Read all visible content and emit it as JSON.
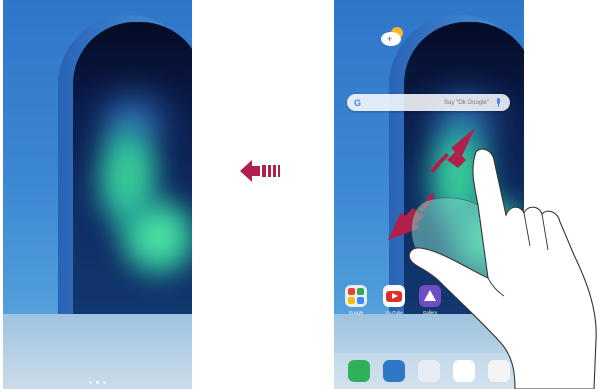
{
  "gesture": {
    "direction_icon": "swipe-left-arrow-icon"
  },
  "left_screen": {
    "page_dots": 3,
    "active_dot": 1
  },
  "right_screen": {
    "weather_icon": "weather-icon",
    "search": {
      "logo": "G",
      "placeholder": "Say \"Ok Google\"",
      "mic_icon": "mic-icon"
    },
    "apps": [
      {
        "label": "Google",
        "icon": "google-folder-icon"
      },
      {
        "label": "YouTube",
        "icon": "youtube-icon"
      },
      {
        "label": "Gallery",
        "icon": "gallery-icon"
      }
    ],
    "dock": [
      "phone-icon",
      "messages-icon",
      "camera-icon",
      "play-store-icon",
      "chrome-icon"
    ]
  },
  "colors": {
    "arrow": "#b0204a",
    "pinch_arrow": "#b0204a",
    "wall": "#3c87d2",
    "aurora": "#43d98a"
  }
}
